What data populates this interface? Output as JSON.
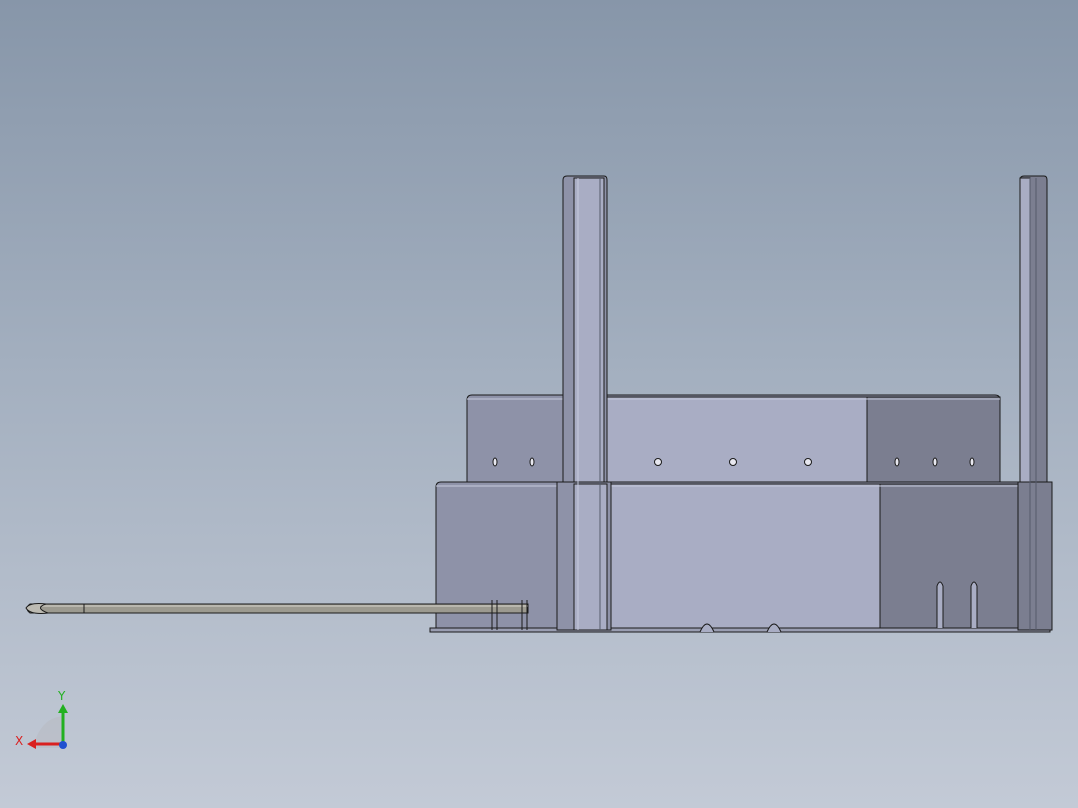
{
  "viewport": {
    "background_top": "#8796a9",
    "background_bottom": "#c3cad6"
  },
  "model": {
    "edge_color": "#1a1a1a",
    "face_light": "#a8aec5",
    "face_mid": "#8e92a8",
    "face_dark": "#7b7e90",
    "face_highlight": "#c5c9dc",
    "rod_color": "#9c9a90"
  },
  "triad": {
    "x_label": "X",
    "y_label": "Y",
    "x_color": "#d92020",
    "y_color": "#22b020",
    "z_color": "#2050d0"
  }
}
